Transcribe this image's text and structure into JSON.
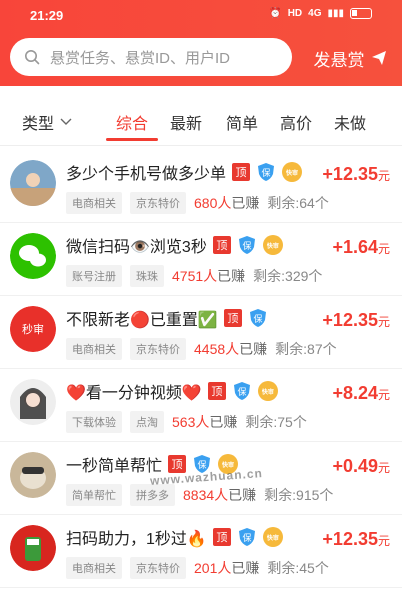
{
  "status_bar": {
    "time": "21:29",
    "network": "4G",
    "hd": "HD"
  },
  "search": {
    "placeholder": "悬赏任务、悬赏ID、用户ID"
  },
  "post_button": {
    "label": "发悬赏"
  },
  "filter": {
    "type_label": "类型"
  },
  "tabs": [
    {
      "label": "综合",
      "active": true
    },
    {
      "label": "最新"
    },
    {
      "label": "简单"
    },
    {
      "label": "高价"
    },
    {
      "label": "未做"
    }
  ],
  "badges": {
    "top": "顶",
    "guarantee": "保",
    "fast": "快审"
  },
  "tasks": [
    {
      "title": "多少个手机号做多少单",
      "reward": "+12.35",
      "unit": "元",
      "tags": [
        "电商相关",
        "京东特价"
      ],
      "earned": "680人",
      "earned_suffix": "已赚",
      "remaining": "剩余:64个",
      "avatar": "photo",
      "has_top": true,
      "has_guarantee": true,
      "has_fast": true
    },
    {
      "title": "微信扫码👁️浏览3秒",
      "reward": "+1.64",
      "unit": "元",
      "tags": [
        "账号注册",
        "珠珠"
      ],
      "earned": "4751人",
      "earned_suffix": "已赚",
      "remaining": "剩余:329个",
      "avatar": "wechat",
      "has_top": true,
      "has_guarantee": true,
      "has_fast": true
    },
    {
      "title": "不限新老🔴已重置✅",
      "reward": "+12.35",
      "unit": "元",
      "tags": [
        "电商相关",
        "京东特价"
      ],
      "earned": "4458人",
      "earned_suffix": "已赚",
      "remaining": "剩余:87个",
      "avatar": "miaoshen",
      "avatar_text": "秒审",
      "has_top": true,
      "has_guarantee": true,
      "has_fast": false
    },
    {
      "title": "❤️看一分钟视频❤️",
      "reward": "+8.24",
      "unit": "元",
      "tags": [
        "下载体验",
        "点淘"
      ],
      "earned": "563人",
      "earned_suffix": "已赚",
      "remaining": "剩余:75个",
      "avatar": "girl",
      "has_top": true,
      "has_guarantee": true,
      "has_fast": true
    },
    {
      "title": "一秒简单帮忙",
      "reward": "+0.49",
      "unit": "元",
      "tags": [
        "简单帮忙",
        "拼多多"
      ],
      "earned": "8834人",
      "earned_suffix": "已赚",
      "remaining": "剩余:915个",
      "avatar": "dog",
      "has_top": true,
      "has_guarantee": true,
      "has_fast": true
    },
    {
      "title": "扫码助力，1秒过🔥",
      "reward": "+12.35",
      "unit": "元",
      "tags": [
        "电商相关",
        "京东特价"
      ],
      "earned": "201人",
      "earned_suffix": "已赚",
      "remaining": "剩余:45个",
      "avatar": "red-cup",
      "has_top": true,
      "has_guarantee": true,
      "has_fast": true
    }
  ],
  "watermark": "www.wazhuan.cn",
  "colors": {
    "brand": "#f8453a",
    "reward": "#f23c31",
    "fast_badge": "#f6b93b",
    "guarantee_badge": "#3aa0f0"
  }
}
